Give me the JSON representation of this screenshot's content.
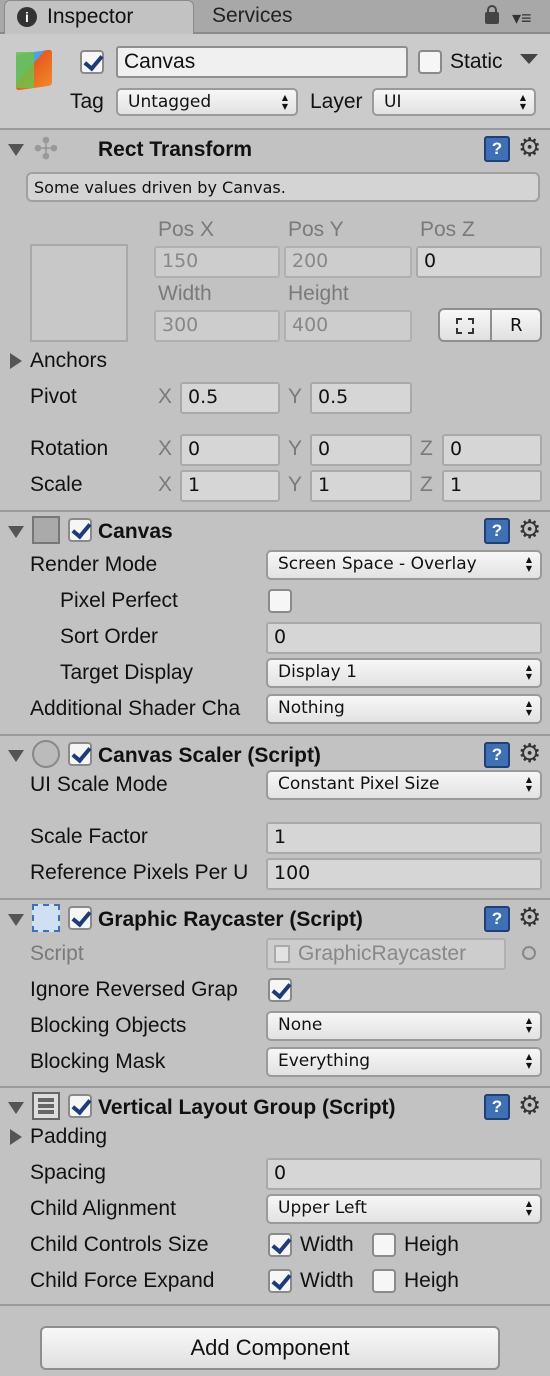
{
  "tabs": {
    "inspector": "Inspector",
    "services": "Services"
  },
  "object": {
    "name": "Canvas",
    "static_label": "Static",
    "tag_label": "Tag",
    "tag_value": "Untagged",
    "layer_label": "Layer",
    "layer_value": "UI"
  },
  "rect_transform": {
    "title": "Rect Transform",
    "notice": "Some values driven by Canvas.",
    "pos_x_label": "Pos X",
    "pos_y_label": "Pos Y",
    "pos_z_label": "Pos Z",
    "pos_x": "150",
    "pos_y": "200",
    "pos_z": "0",
    "width_label": "Width",
    "height_label": "Height",
    "width": "300",
    "height": "400",
    "r_button": "R",
    "anchors_label": "Anchors",
    "pivot_label": "Pivot",
    "pivot_x": "0.5",
    "pivot_y": "0.5",
    "rotation_label": "Rotation",
    "rot_x": "0",
    "rot_y": "0",
    "rot_z": "0",
    "scale_label": "Scale",
    "scale_x": "1",
    "scale_y": "1",
    "scale_z": "1",
    "x": "X",
    "y": "Y",
    "z": "Z"
  },
  "canvas": {
    "title": "Canvas",
    "render_mode_label": "Render Mode",
    "render_mode": "Screen Space - Overlay",
    "pixel_perfect_label": "Pixel Perfect",
    "sort_order_label": "Sort Order",
    "sort_order": "0",
    "target_display_label": "Target Display",
    "target_display": "Display 1",
    "shader_label": "Additional Shader Cha",
    "shader_value": "Nothing"
  },
  "canvas_scaler": {
    "title": "Canvas Scaler (Script)",
    "ui_scale_mode_label": "UI Scale Mode",
    "ui_scale_mode": "Constant Pixel Size",
    "scale_factor_label": "Scale Factor",
    "scale_factor": "1",
    "ref_pixels_label": "Reference Pixels Per U",
    "ref_pixels": "100"
  },
  "graphic_raycaster": {
    "title": "Graphic Raycaster (Script)",
    "script_label": "Script",
    "script_value": "GraphicRaycaster",
    "ignore_reversed_label": "Ignore Reversed Grap",
    "blocking_objects_label": "Blocking Objects",
    "blocking_objects": "None",
    "blocking_mask_label": "Blocking Mask",
    "blocking_mask": "Everything"
  },
  "vertical_layout": {
    "title": "Vertical Layout Group (Script)",
    "padding_label": "Padding",
    "spacing_label": "Spacing",
    "spacing": "0",
    "child_alignment_label": "Child Alignment",
    "child_alignment": "Upper Left",
    "child_controls_label": "Child Controls Size",
    "child_force_label": "Child Force Expand",
    "width_label": "Width",
    "height_label": "Heigh"
  },
  "add_component": "Add Component",
  "colors": {
    "panel": "#c2c2c2",
    "header": "#cbcbcb",
    "accent": "#3f6fb5"
  }
}
